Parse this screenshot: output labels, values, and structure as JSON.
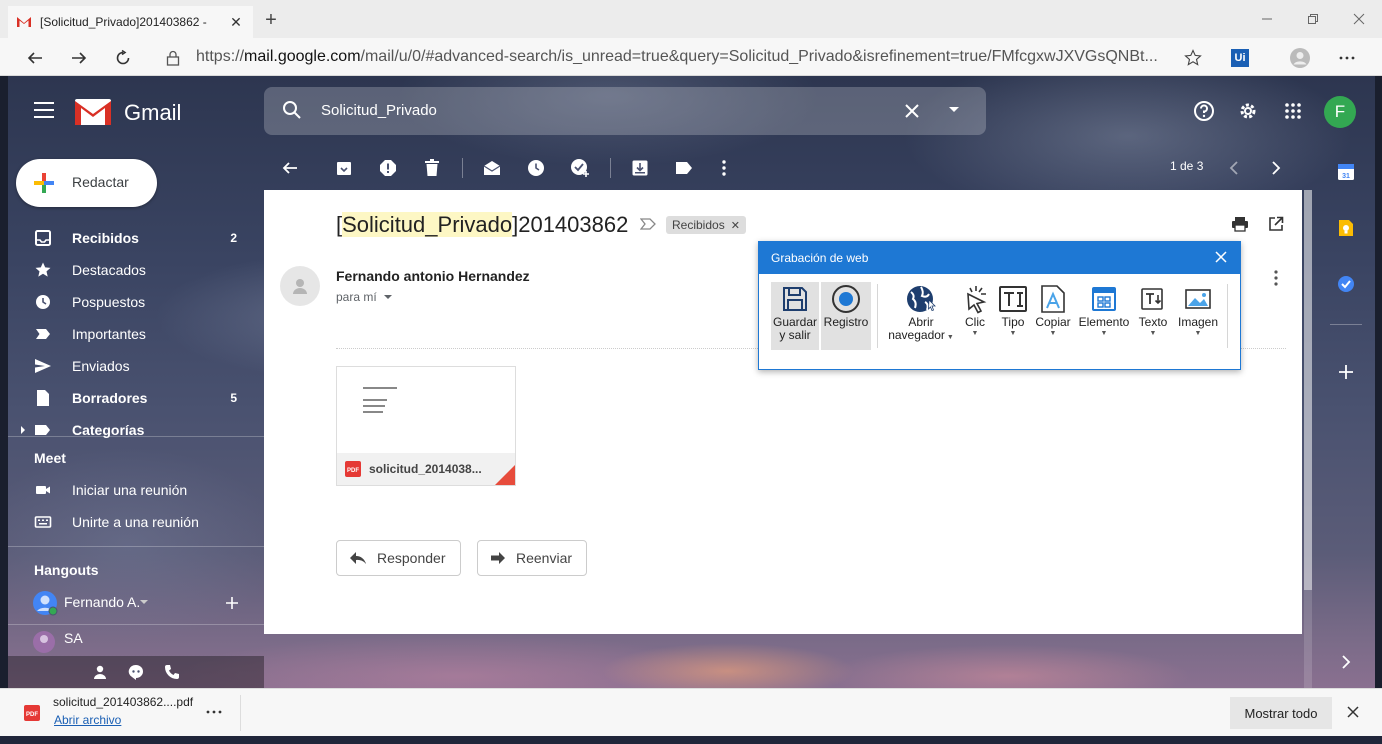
{
  "browser": {
    "tab_title": "[Solicitud_Privado]201403862 - ",
    "url_prefix": "https://",
    "url_host": "mail.google.com",
    "url_path": "/mail/u/0/#advanced-search/is_unread=true&query=Solicitud_Privado&isrefinement=true/FMfcgxwJXVGsQNBt...",
    "ext_label": "Ui"
  },
  "gmail": {
    "brand": "Gmail",
    "search_query": "Solicitud_Privado",
    "account_initial": "F",
    "accent": "#33a852"
  },
  "nav": {
    "compose": "Redactar",
    "items": [
      {
        "label": "Recibidos",
        "count": "2"
      },
      {
        "label": "Destacados",
        "count": ""
      },
      {
        "label": "Pospuestos",
        "count": ""
      },
      {
        "label": "Importantes",
        "count": ""
      },
      {
        "label": "Enviados",
        "count": ""
      },
      {
        "label": "Borradores",
        "count": "5"
      },
      {
        "label": "Categorías",
        "count": ""
      }
    ],
    "meet_title": "Meet",
    "meet_items": [
      "Iniciar una reunión",
      "Unirte a una reunión"
    ],
    "hangouts_title": "Hangouts",
    "hangouts_user": "Fernando A.",
    "hangouts_contact": "SA"
  },
  "toolbar": {
    "pager": "1 de 3"
  },
  "message": {
    "subject_open": "[",
    "subject_highlight": "Solicitud_Privado",
    "subject_rest": "]201403862",
    "label_chip": "Recibidos",
    "sender": "Fernando antonio Hernandez",
    "to": "para mí",
    "attachment_name": "solicitud_2014038...",
    "reply": "Responder",
    "forward": "Reenviar"
  },
  "recorder": {
    "title": "Grabación de web",
    "buttons": [
      {
        "line1": "Guardar",
        "line2": "y salir"
      },
      {
        "line1": "Registro",
        "line2": ""
      },
      {
        "line1": "Abrir",
        "line2": "navegador"
      },
      {
        "line1": "Clic",
        "line2": ""
      },
      {
        "line1": "Tipo",
        "line2": ""
      },
      {
        "line1": "Copiar",
        "line2": ""
      },
      {
        "line1": "Elemento",
        "line2": ""
      },
      {
        "line1": "Texto",
        "line2": ""
      },
      {
        "line1": "Imagen",
        "line2": ""
      }
    ]
  },
  "downloads": {
    "file": "solicitud_201403862....pdf",
    "open": "Abrir archivo",
    "show_all": "Mostrar todo"
  }
}
